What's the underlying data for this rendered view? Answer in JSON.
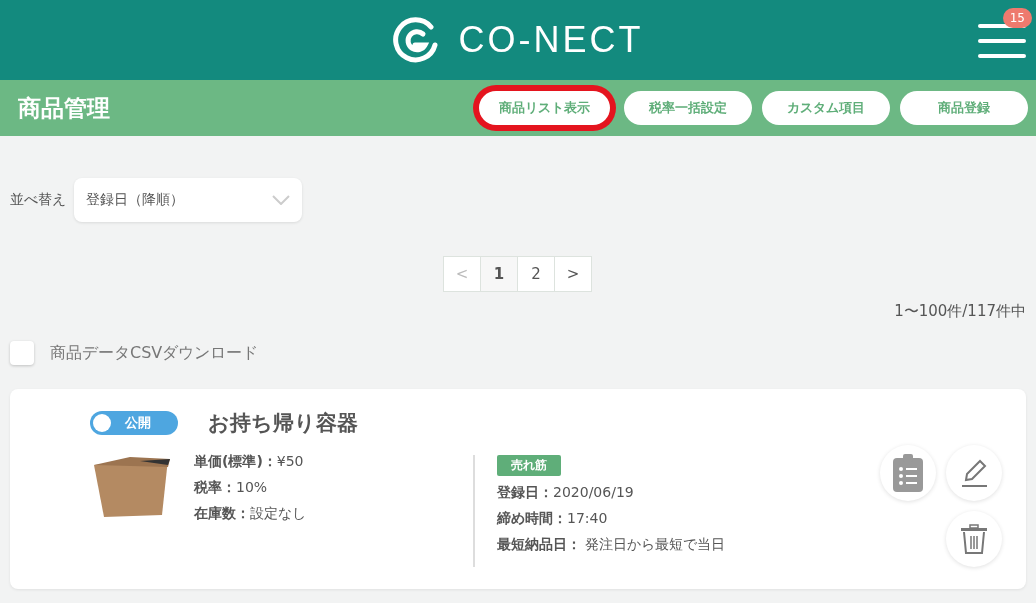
{
  "header": {
    "logo_text": "CO-NECT",
    "notification_count": "15"
  },
  "title_bar": {
    "title": "商品管理",
    "buttons": [
      {
        "label": "商品リスト表示",
        "highlighted": true
      },
      {
        "label": "税率一括設定",
        "highlighted": false
      },
      {
        "label": "カスタム項目",
        "highlighted": false
      },
      {
        "label": "商品登録",
        "highlighted": false
      }
    ]
  },
  "sort": {
    "label": "並べ替え",
    "value": "登録日（降順）"
  },
  "pagination": {
    "prev": {
      "label": "<",
      "disabled": true
    },
    "pages": [
      {
        "label": "1",
        "selected": true
      },
      {
        "label": "2",
        "selected": false
      }
    ],
    "next": {
      "label": ">",
      "disabled": false
    }
  },
  "result_count": "1〜100件/117件中",
  "csv_download": {
    "label": "商品データCSVダウンロード",
    "checked": false
  },
  "products": [
    {
      "name": "お持ち帰り容器",
      "status": {
        "label": "公開",
        "on": true
      },
      "details": [
        "**単価(標準)：**¥50",
        "**税率：**10%",
        "**在庫数：**設定なし"
      ],
      "tag": "売れ筋",
      "info": [
        "**登録日：**2020/06/19",
        "**締め時間：**17:40",
        "**最短納品日：** 発注日から最短で当日"
      ]
    }
  ]
}
